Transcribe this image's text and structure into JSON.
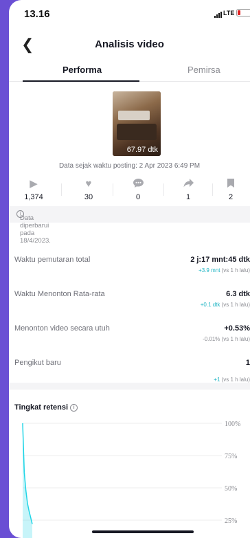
{
  "status_bar": {
    "time": "13.16",
    "network": "LTE"
  },
  "header": {
    "title": "Analisis video"
  },
  "tabs": [
    {
      "label": "Performa",
      "active": true
    },
    {
      "label": "Pemirsa",
      "active": false
    }
  ],
  "video": {
    "duration": "67.97 dtk",
    "posted_text": "Data sejak waktu posting: 2 Apr 2023 6:49 PM"
  },
  "stats": [
    {
      "icon": "play-icon",
      "value": "1,374"
    },
    {
      "icon": "heart-icon",
      "value": "30"
    },
    {
      "icon": "comment-icon",
      "value": "0"
    },
    {
      "icon": "share-icon",
      "value": "1"
    },
    {
      "icon": "bookmark-icon",
      "value": "2"
    }
  ],
  "updated_text": "Data diperbarui pada 18/4/2023.",
  "metrics": [
    {
      "label": "Waktu pemutaran total",
      "value": "2 j:17 mnt:45 dtk",
      "delta_value": "+3.9 mnt",
      "delta_suffix": " (vs 1 h lalu)"
    },
    {
      "label": "Waktu Menonton Rata-rata",
      "value": "6.3 dtk",
      "delta_value": "+0.1 dtk",
      "delta_suffix": " (vs 1 h lalu)"
    },
    {
      "label": "Menonton video secara utuh",
      "value": "+0.53%",
      "delta_value": "-0.01%",
      "delta_suffix": " (vs 1 h lalu)"
    },
    {
      "label": "Pengikut baru",
      "value": "1",
      "delta_value": "+1",
      "delta_suffix": " (vs 1 h lalu)"
    }
  ],
  "retention": {
    "title": "Tingkat retensi",
    "chart_data": {
      "type": "area",
      "ylabel": "",
      "ylim": [
        0,
        100
      ],
      "y_ticks": [
        "100%",
        "75%",
        "50%",
        "25%"
      ],
      "color": "#20d5e6",
      "x": [
        0,
        1,
        2,
        3,
        4,
        5,
        6
      ],
      "values": [
        100,
        62,
        48,
        38,
        32,
        27,
        22
      ]
    }
  },
  "colors": {
    "accent": "#20b5c4",
    "text": "#161823",
    "muted": "#8a8b91",
    "battery_low": "#e02020"
  }
}
